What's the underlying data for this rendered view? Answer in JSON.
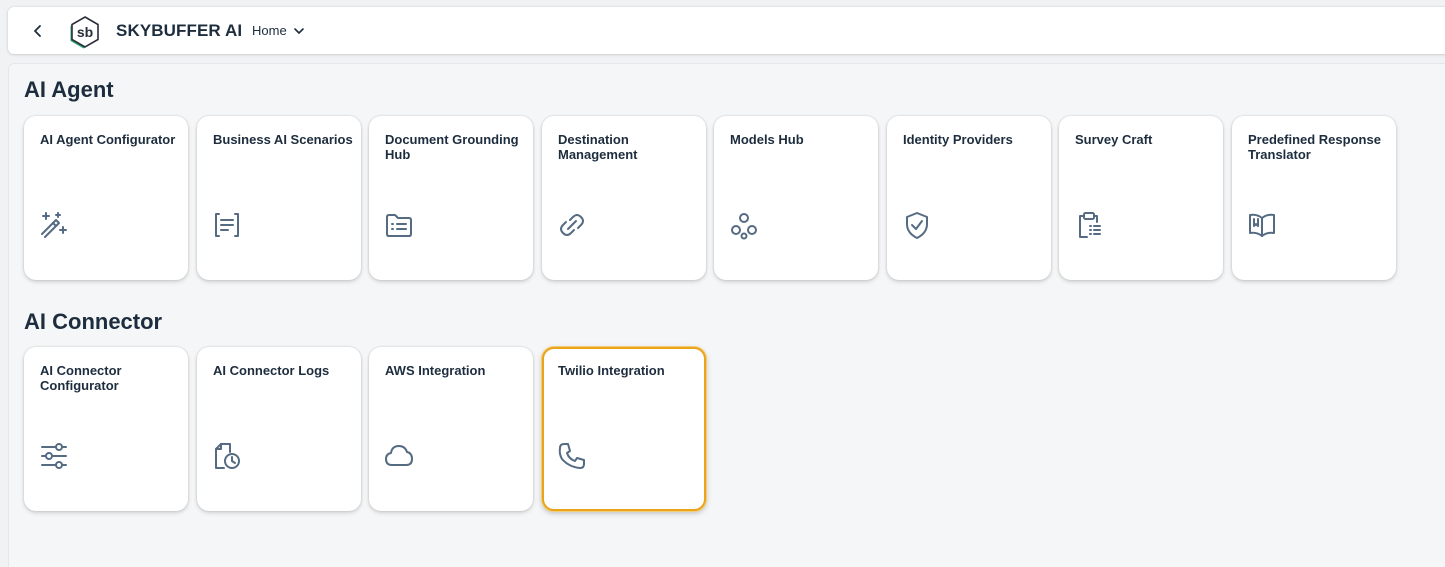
{
  "header": {
    "brand": "SKYBUFFER AI",
    "logo_text": "sb",
    "home_menu": "Home"
  },
  "sections": [
    {
      "title": "AI Agent",
      "tiles": [
        {
          "title": "AI Agent Configurator",
          "icon": "magic-wand-icon"
        },
        {
          "title": "Business AI Scenarios",
          "icon": "document-text-icon"
        },
        {
          "title": "Document Grounding Hub",
          "icon": "folder-list-icon"
        },
        {
          "title": "Destination Management",
          "icon": "chain-link-icon"
        },
        {
          "title": "Models Hub",
          "icon": "network-nodes-icon"
        },
        {
          "title": "Identity Providers",
          "icon": "shield-check-icon"
        },
        {
          "title": "Survey Craft",
          "icon": "clipboard-list-icon"
        },
        {
          "title": "Predefined Response Translator",
          "icon": "open-book-icon"
        }
      ]
    },
    {
      "title": "AI Connector",
      "tiles": [
        {
          "title": "AI Connector Configurator",
          "icon": "sliders-icon"
        },
        {
          "title": "AI Connector Logs",
          "icon": "document-clock-icon"
        },
        {
          "title": "AWS Integration",
          "icon": "cloud-icon"
        },
        {
          "title": "Twilio Integration",
          "icon": "phone-icon",
          "focused": true
        }
      ]
    }
  ],
  "colors": {
    "text": "#1d2d3e",
    "icon": "#556b82",
    "focus": "#e9a41a",
    "logo_accent": "#2fa876"
  }
}
